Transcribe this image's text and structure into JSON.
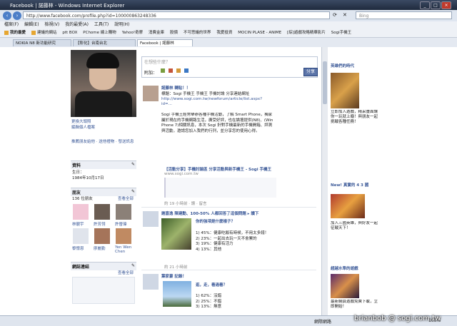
{
  "window": {
    "title": "Facebook | 諾藤林 - Windows Internet Explorer"
  },
  "address": {
    "url": "http://www.facebook.com/profile.php?id=100000863248336",
    "search_placeholder": "Bing"
  },
  "menu": [
    "檔案(F)",
    "編輯(E)",
    "檢視(V)",
    "我的最愛(A)",
    "工具(T)",
    "說明(H)"
  ],
  "favorites": [
    "我的最愛",
    "建議的網站",
    "ptt BOX",
    "PChome 線上購物",
    "Yahoo!奇摩",
    "消費金庫",
    "股價",
    "不可思議的世界",
    "我愛投資",
    "MOCIN PLASE - ANIME",
    "[綜]遊戲攻略精華影片",
    "Sogi手機王"
  ],
  "tabs": [
    "NOKIA N8 新功能研究",
    "【彰化】台南台北",
    "Facebook | 諾藤林"
  ],
  "profile": {
    "edit_photo": "更換大頭照",
    "view_photos": "編輯個人檔案",
    "links": "推薦朋友給他 · 送他禮物 · 發送訊息",
    "info_head": "資料",
    "info_body": "生日：\n1984年10月17日",
    "friends_head": "朋友",
    "friends_count": "136 位朋友",
    "friends_more": "查看全部",
    "friend_names": [
      "林靚宇",
      "許芳翎",
      "許晉瑋",
      "黎懷恩",
      "廖麗勤",
      "Yen Wen Chen"
    ],
    "links_head": "網誌連結",
    "links_more": "查看全部"
  },
  "status": {
    "placeholder": "在想些什麼？",
    "attach_label": "附加：",
    "share_label": "分享"
  },
  "posts": [
    {
      "author": "諾藤林 轉貼！！",
      "title": "標題：Sogi 手機王 手機王 手機討論 分享連結網址",
      "url": "http://www.sogi.com.tw/newforum/article/list.aspx?id=...",
      "body": "Sogi 手機王經常舉辦各種手機活動，了解 Smart Phone，獨家屬於現在的手機網路生活，廣受好評，也在論壇提供(N8)、(Win Phone 7)相關訊息，本次 Sogi 針對手機最新的手機開箱、評測與活動，邀請您加入我們的行列，並分享您的使用心得。",
      "footer": "【活動分享】手機討論區 分享活動與新手機王 - Sogi 手機王",
      "meta": "www.sogi.com.tw",
      "time": "約 19 小時前 · 讚 · 留言"
    },
    {
      "author": "謝嘉逸 陳建勳、100-50% 人都回答了這個問題 ▸ 讀下",
      "title": "你的強項是什麼樣子？",
      "body": "1) 45%：健康吃飯有時候，不用太多錢！\n2) 23%：一起出去玩一天不會累的\n3) 19%：健康有活力\n4) 13%：其他",
      "time": "約 21 小時前"
    },
    {
      "author": "葉家豪 記錄！",
      "title": "逛，走，看過看？",
      "body": "1) 62%：沒錯\n2) 25%：不錯\n3) 13%：無意",
      "time": "約 1 天前"
    }
  ],
  "right": {
    "ad1_title": "英雄們的時代",
    "ad1_text": "立即加入遊戲，精采畫面讓你一玩就上癮！與朋友一起挑戰各種任務！",
    "ad2_title": "New! 真實的 4 3 國",
    "ad2_text": "加入三國英雄，與好友一起征戰天下！",
    "ad3_title": "超越水準的遊戲",
    "ad3_text": "最新網頁遊戲免費下載，立即開始！"
  },
  "statusbar": {
    "zone": "網際網路",
    "zoom": "100%"
  },
  "watermark": "brianbob @ sogi.com.tw"
}
